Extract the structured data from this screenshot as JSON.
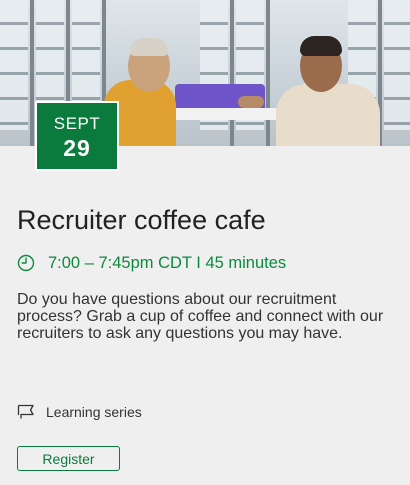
{
  "event": {
    "date": {
      "month": "SEPT",
      "day": "29"
    },
    "title": "Recruiter coffee cafe",
    "time": "7:00 – 7:45pm CDT I 45 minutes",
    "description": "Do you have questions about our recruitment process? Grab a cup of coffee and connect with our recruiters to ask any questions you may have.",
    "series": "Learning series",
    "register_label": "Register"
  },
  "icons": {
    "time": "clock-icon",
    "series": "flag-icon"
  },
  "colors": {
    "brand_green": "#0b7a3d",
    "time_text": "#0b8a3e",
    "card_background": "#efefef"
  }
}
